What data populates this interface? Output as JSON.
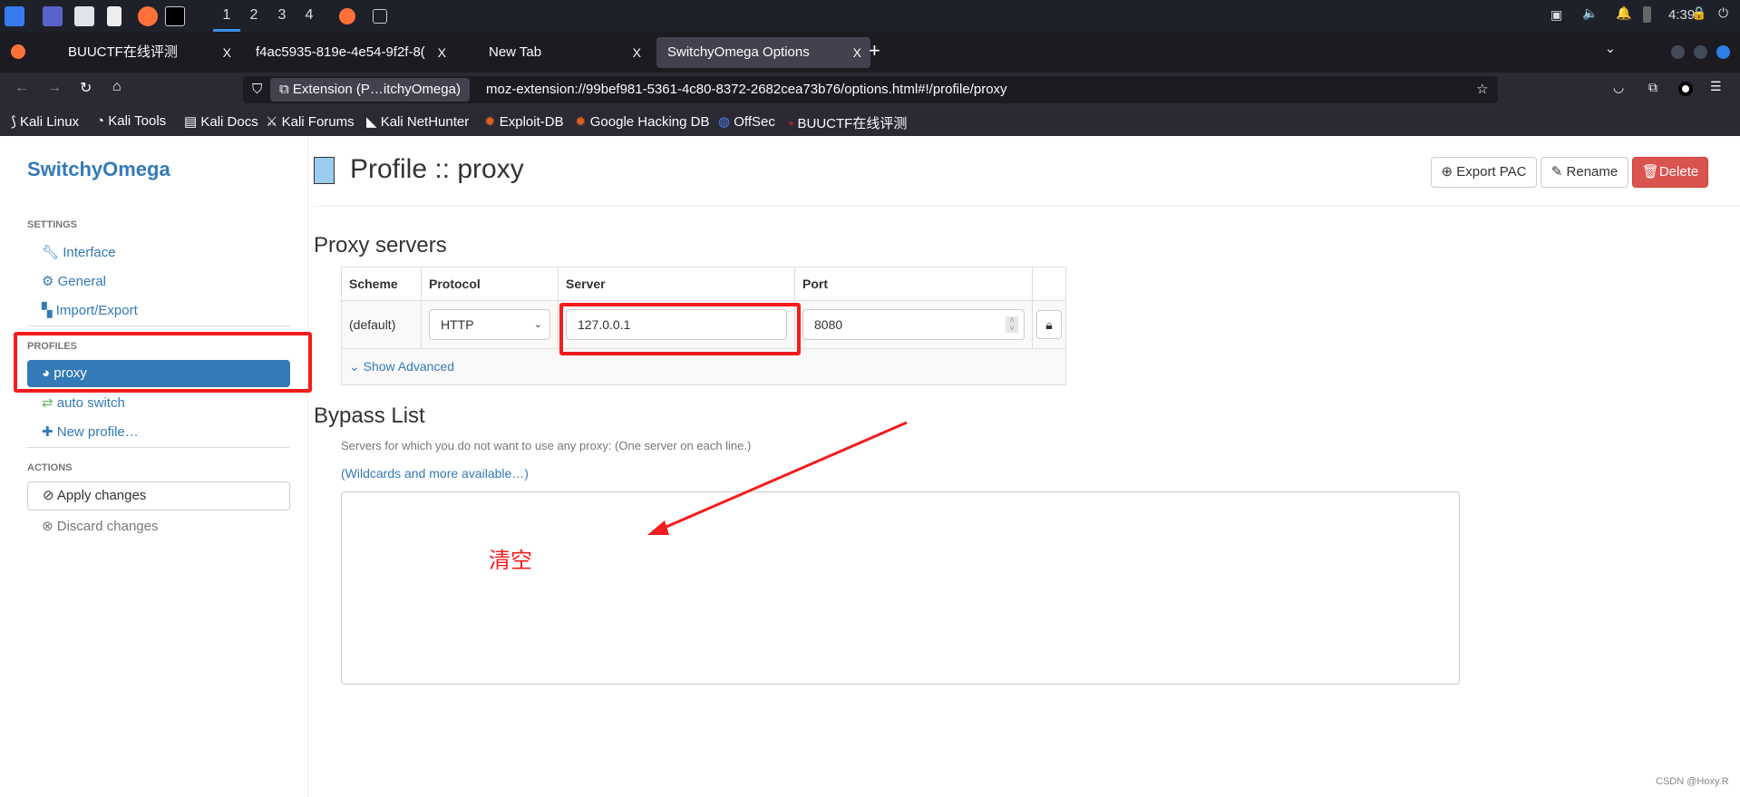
{
  "taskbar": {
    "workspaces": [
      "1",
      "2",
      "3",
      "4"
    ],
    "active_workspace": "1",
    "clock": "4:39"
  },
  "tabs": [
    {
      "title": "BUUCTF在线评测"
    },
    {
      "title": "f4ac5935-819e-4e54-9f2f-8("
    },
    {
      "title": "New Tab"
    },
    {
      "title": "SwitchyOmega Options",
      "selected": true
    }
  ],
  "tab_close": "X",
  "new_tab": "+",
  "urlbar": {
    "identity": "Extension (P…itchyOmega)",
    "url": "moz-extension://99bef981-5361-4c80-8372-2682cea73b76/options.html#!/profile/proxy"
  },
  "bookmarks": [
    "Kali Linux",
    "Kali Tools",
    "Kali Docs",
    "Kali Forums",
    "Kali NetHunter",
    "Exploit-DB",
    "Google Hacking DB",
    "OffSec",
    "BUUCTF在线评测"
  ],
  "sidebar": {
    "brand": "SwitchyOmega",
    "settings_header": "SETTINGS",
    "settings": [
      "Interface",
      "General",
      "Import/Export"
    ],
    "profiles_header": "PROFILES",
    "profiles": [
      "proxy",
      "auto switch",
      "New profile…"
    ],
    "actions_header": "ACTIONS",
    "apply": "Apply changes",
    "discard": "Discard changes"
  },
  "main": {
    "title": "Profile :: proxy",
    "profile_color": "#99ccee",
    "buttons": {
      "export": "Export PAC",
      "rename": "Rename",
      "delete": "Delete"
    },
    "proxy_heading": "Proxy servers",
    "columns": [
      "Scheme",
      "Protocol",
      "Server",
      "Port"
    ],
    "row": {
      "scheme": "(default)",
      "protocol": "HTTP",
      "server": "127.0.0.1",
      "port": "8080"
    },
    "show_advanced": "Show Advanced",
    "bypass_heading": "Bypass List",
    "bypass_desc": "Servers for which you do not want to use any proxy: (One server on each line.)",
    "bypass_link": "(Wildcards and more available…)",
    "bypass_value": ""
  },
  "annotation": {
    "text": "清空",
    "color": "#f41c1c"
  },
  "watermark": "CSDN @Hoxy.R"
}
